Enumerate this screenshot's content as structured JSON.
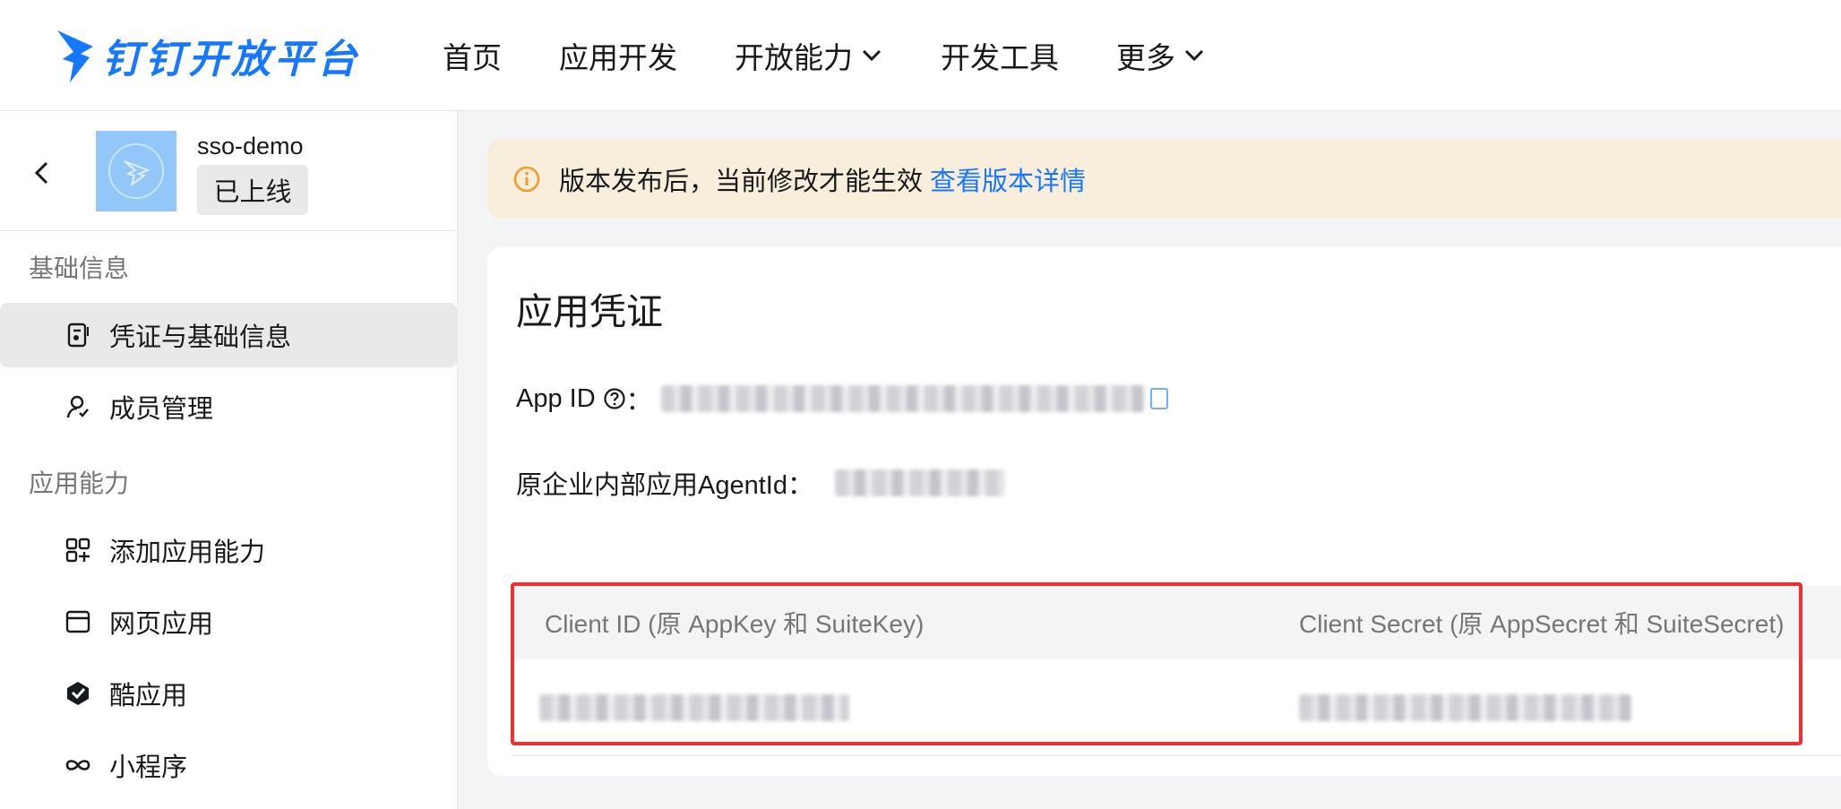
{
  "brand": {
    "name": "钉钉开放平台",
    "color": "#1677ff"
  },
  "nav": {
    "items": [
      {
        "label": "首页",
        "has_dropdown": false
      },
      {
        "label": "应用开发",
        "has_dropdown": false
      },
      {
        "label": "开放能力",
        "has_dropdown": true
      },
      {
        "label": "开发工具",
        "has_dropdown": false
      },
      {
        "label": "更多",
        "has_dropdown": true
      }
    ]
  },
  "sidebar": {
    "app": {
      "name": "sso-demo",
      "status": "已上线"
    },
    "sections": [
      {
        "title": "基础信息",
        "items": [
          {
            "label": "凭证与基础信息",
            "icon": "credential-icon",
            "active": true
          }
        ]
      },
      {
        "members": {
          "label": "成员管理",
          "icon": "user-icon"
        }
      },
      {
        "title": "应用能力",
        "items": [
          {
            "label": "添加应用能力",
            "icon": "add-ability-icon"
          },
          {
            "label": "网页应用",
            "icon": "browser-window-icon"
          },
          {
            "label": "酷应用",
            "icon": "cool-app-icon"
          },
          {
            "label": "小程序",
            "icon": "infinity-icon"
          }
        ]
      }
    ]
  },
  "alert": {
    "text": "版本发布后，当前修改才能生效",
    "link": "查看版本详情",
    "background": "#f9eedc",
    "icon_color": "#f59a23"
  },
  "card": {
    "title": "应用凭证",
    "app_id_label": "App ID",
    "app_id_colon": "：",
    "agent_id_label": "原企业内部应用AgentId：",
    "table": {
      "col1_header": "Client ID (原 AppKey 和 SuiteKey)",
      "col2_header": "Client Secret (原 AppSecret 和 SuiteSecret)"
    },
    "highlight_color": "#f0302e"
  }
}
